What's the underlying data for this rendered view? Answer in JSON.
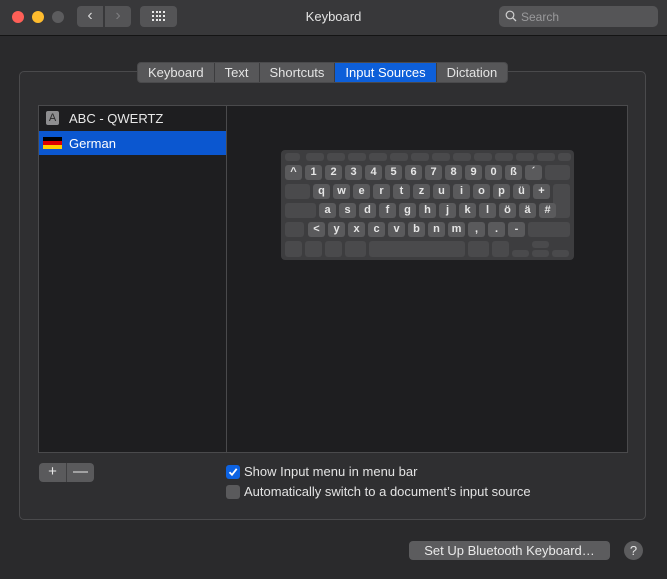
{
  "window": {
    "title": "Keyboard",
    "search_placeholder": "Search",
    "back_icon": "‹",
    "forward_icon": "›"
  },
  "tabs": [
    {
      "label": "Keyboard",
      "active": false
    },
    {
      "label": "Text",
      "active": false
    },
    {
      "label": "Shortcuts",
      "active": false
    },
    {
      "label": "Input Sources",
      "active": true
    },
    {
      "label": "Dictation",
      "active": false
    }
  ],
  "input_sources": [
    {
      "label": "ABC - QWERTZ",
      "icon": "A",
      "selected": false
    },
    {
      "label": "German",
      "icon": "german-flag",
      "selected": true
    }
  ],
  "flag_colors": [
    "#000000",
    "#dd0000",
    "#ffce00"
  ],
  "keyboard": {
    "row1": [
      "^",
      "1",
      "2",
      "3",
      "4",
      "5",
      "6",
      "7",
      "8",
      "9",
      "0",
      "ß",
      "´"
    ],
    "row2": [
      "q",
      "w",
      "e",
      "r",
      "t",
      "z",
      "u",
      "i",
      "o",
      "p",
      "ü",
      "+"
    ],
    "row3": [
      "a",
      "s",
      "d",
      "f",
      "g",
      "h",
      "j",
      "k",
      "l",
      "ö",
      "ä",
      "#"
    ],
    "row4": [
      "<",
      "y",
      "x",
      "c",
      "v",
      "b",
      "n",
      "m",
      ",",
      ".",
      "-"
    ]
  },
  "list_controls": {
    "add": "+",
    "remove": "—"
  },
  "options": [
    {
      "label": "Show Input menu in menu bar",
      "checked": true
    },
    {
      "label": "Automatically switch to a document’s input source",
      "checked": false
    }
  ],
  "bluetooth_button": "Set Up Bluetooth Keyboard…",
  "help_label": "?"
}
